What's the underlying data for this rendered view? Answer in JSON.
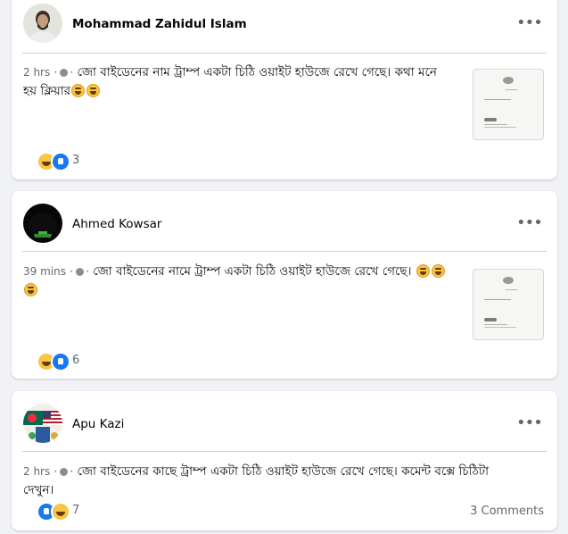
{
  "posts": [
    {
      "author": "Mohammad Zahidul Islam",
      "time": "2 hrs",
      "text": "জো বাইডেনের নাম ট্রাম্প একটা চিঠি ওয়াইট হাউজে রেখে গেছে। কথা মনে হয় ক্লিয়ার",
      "reaction_count": "3",
      "reactions": [
        "haha",
        "like"
      ]
    },
    {
      "author": "Ahmed Kowsar",
      "time": "39 mins",
      "text": "জো বাইডেনের নামে ট্রাম্প একটা চিঠি ওয়াইট হাউজে রেখে গেছে।",
      "reaction_count": "6",
      "reactions": [
        "haha",
        "like"
      ]
    },
    {
      "author": "Apu Kazi",
      "time": "2 hrs",
      "text": "জো বাইডেনের কাছে ট্রাম্প একটা চিঠি ওয়াইট হাউজে রেখে গেছে। কমেন্ট বক্সে চিঠিটা দেখুন।",
      "reaction_count": "7",
      "reactions": [
        "like",
        "haha"
      ],
      "comments_label": "3 Comments"
    }
  ],
  "icons": {
    "more": "more-horizontal-icon",
    "audience": "globe-icon",
    "emoji": "laughing-emoji-icon"
  },
  "colors": {
    "background": "#f0f2f5",
    "card": "#ffffff",
    "secondary_text": "#65676b",
    "like_blue": "#1877f2",
    "haha_yellow": "#f7c644"
  }
}
